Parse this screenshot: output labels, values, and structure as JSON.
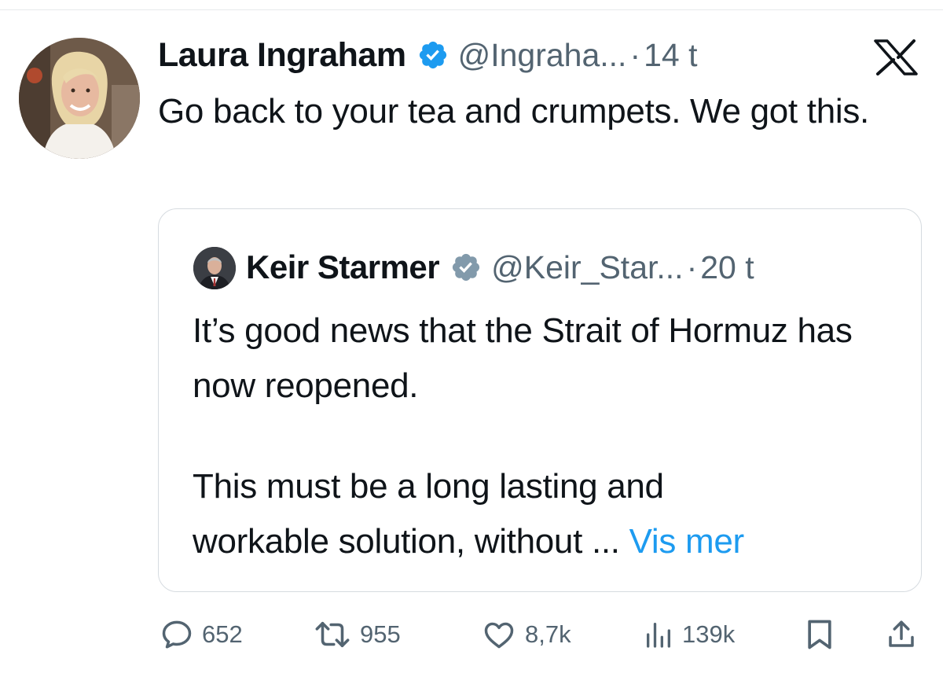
{
  "tweet": {
    "author_name": "Laura Ingraham",
    "author_handle": "@Ingraha...",
    "separator": "·",
    "time": "14 t",
    "text": "Go back to your tea and crumpets.  We got this.",
    "platform_icon": "x-logo-icon"
  },
  "quoted_tweet": {
    "author_name": "Keir Starmer",
    "author_handle": "@Keir_Star...",
    "separator": "·",
    "time": "20 t",
    "paragraph1": "It’s good news that the Strait of Hormuz has now reopened.",
    "paragraph2_line1": "This must be a long lasting and",
    "paragraph2_line2": "workable solution, without ...",
    "show_more": "Vis mer"
  },
  "actions": {
    "replies": "652",
    "reposts": "955",
    "likes": "8,7k",
    "views": "139k"
  },
  "colors": {
    "text": "#0f1419",
    "secondary": "#536471",
    "link": "#1d9bf0",
    "verified": "#1d9bf0",
    "border": "#d6dbe0"
  }
}
